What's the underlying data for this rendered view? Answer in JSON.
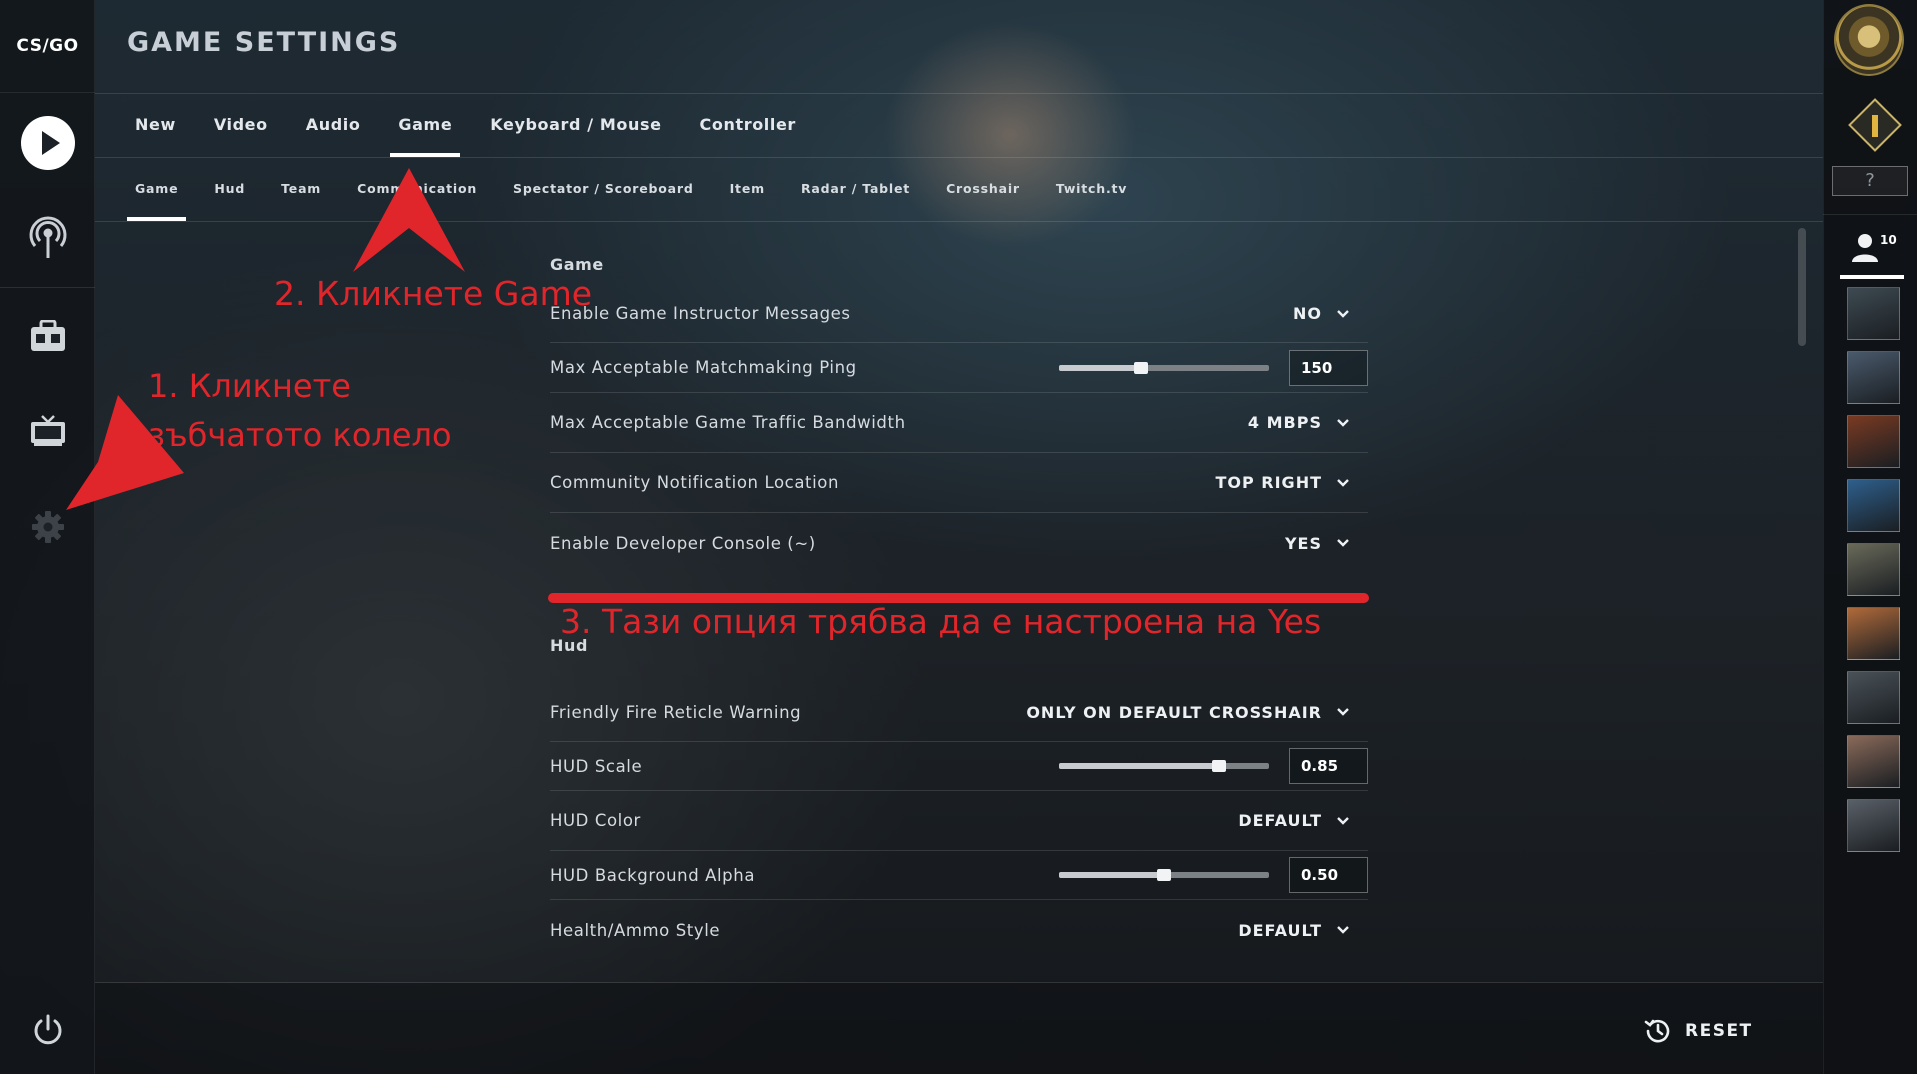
{
  "app": {
    "logo_text": "CS/GO",
    "title": "GAME SETTINGS"
  },
  "left_sidebar": {
    "icons": [
      "play-icon",
      "broadcast-icon",
      "inventory-icon",
      "tv-icon",
      "gear-icon",
      "power-icon"
    ]
  },
  "main_tabs": [
    {
      "label": "New",
      "active": false
    },
    {
      "label": "Video",
      "active": false
    },
    {
      "label": "Audio",
      "active": false
    },
    {
      "label": "Game",
      "active": true
    },
    {
      "label": "Keyboard / Mouse",
      "active": false
    },
    {
      "label": "Controller",
      "active": false
    }
  ],
  "sub_tabs": [
    {
      "label": "Game",
      "active": true
    },
    {
      "label": "Hud",
      "active": false
    },
    {
      "label": "Team",
      "active": false
    },
    {
      "label": "Communication",
      "active": false
    },
    {
      "label": "Spectator / Scoreboard",
      "active": false
    },
    {
      "label": "Item",
      "active": false
    },
    {
      "label": "Radar / Tablet",
      "active": false
    },
    {
      "label": "Crosshair",
      "active": false
    },
    {
      "label": "Twitch.tv",
      "active": false
    }
  ],
  "sections": [
    {
      "title": "Game",
      "rows": [
        {
          "label": "Enable Game Instructor Messages",
          "type": "dropdown",
          "value": "NO"
        },
        {
          "label": "Max Acceptable Matchmaking Ping",
          "type": "slider",
          "value": "150",
          "fraction": 0.39
        },
        {
          "label": "Max Acceptable Game Traffic Bandwidth",
          "type": "dropdown",
          "value": "4 MBPS"
        },
        {
          "label": "Community Notification Location",
          "type": "dropdown",
          "value": "TOP RIGHT"
        },
        {
          "label": "Enable Developer Console (~)",
          "type": "dropdown",
          "value": "YES"
        }
      ]
    },
    {
      "title": "Hud",
      "rows": [
        {
          "label": "Friendly Fire Reticle Warning",
          "type": "dropdown",
          "value": "ONLY ON DEFAULT CROSSHAIR"
        },
        {
          "label": "HUD Scale",
          "type": "slider",
          "value": "0.85",
          "fraction": 0.76
        },
        {
          "label": "HUD Color",
          "type": "dropdown",
          "value": "DEFAULT"
        },
        {
          "label": "HUD Background Alpha",
          "type": "slider",
          "value": "0.50",
          "fraction": 0.5
        },
        {
          "label": "Health/Ammo Style",
          "type": "dropdown",
          "value": "DEFAULT"
        }
      ]
    }
  ],
  "annotations": {
    "step1": "1. Кликнете зъбчатото колело",
    "step2": "2. Кликнете Game",
    "step3": "3. Тази опция трябва да е настроена на Yes",
    "color": "#e0262b"
  },
  "footer": {
    "reset_label": "RESET"
  },
  "right_sidebar": {
    "help_label": "?",
    "friends_count": "10",
    "avatar_colors": [
      "#3e4a52",
      "#4a5a6c",
      "#7a3a22",
      "#2e5f8c",
      "#6a6a5a",
      "#b06a3a",
      "#4a5258",
      "#8a6a5a",
      "#5a6068"
    ]
  }
}
